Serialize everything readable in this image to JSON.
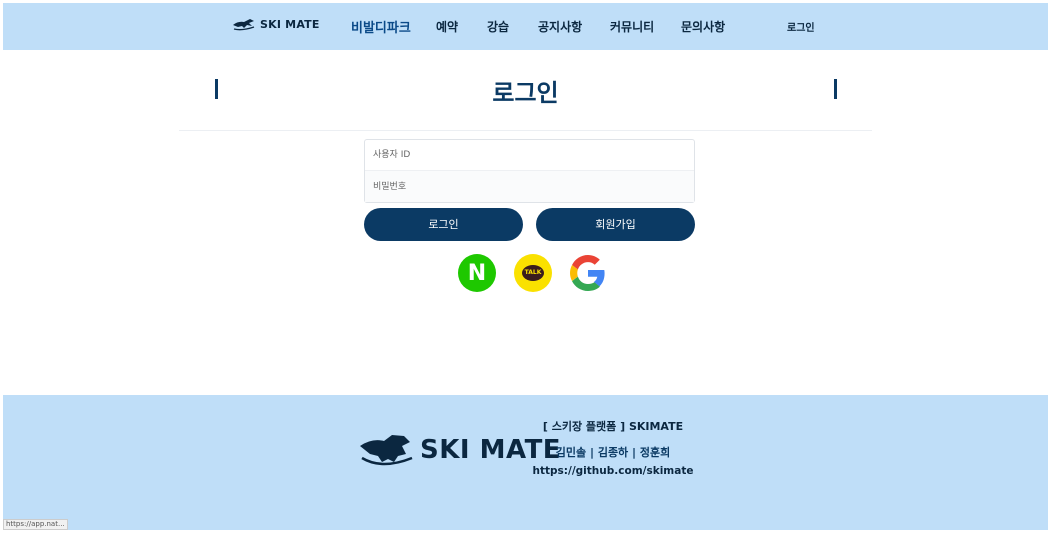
{
  "header": {
    "logo_text": "SKI MATE",
    "nav": [
      "비발디파크",
      "예약",
      "강습",
      "공지사항",
      "커뮤니티",
      "문의사항"
    ],
    "login_link": "로그인"
  },
  "page": {
    "title": "로그인"
  },
  "form": {
    "id_placeholder": "사용자 ID",
    "password_placeholder": "비밀번호",
    "login_button": "로그인",
    "signup_button": "회원가입"
  },
  "social": {
    "naver_letter": "N",
    "kakao_label": "TALK"
  },
  "footer": {
    "logo_text": "SKI MATE",
    "line1": "[ 스키장 플랫폼 ]    SKIMATE",
    "line2": "김민솔   |   김종하   |   정훈희",
    "line3": "https://github.com/skimate"
  },
  "status_bar": "https://app.nat...",
  "colors": {
    "primary": "#0b3a64",
    "header_bg": "#bfdef8",
    "naver": "#1ec800",
    "kakao": "#fae100"
  }
}
